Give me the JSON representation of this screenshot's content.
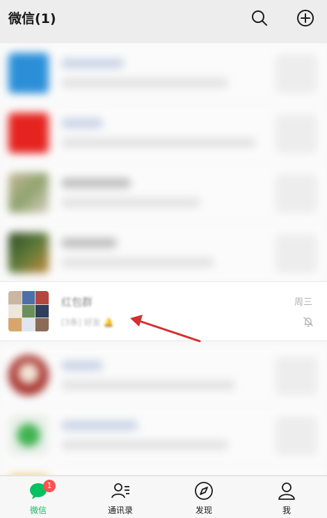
{
  "header": {
    "title": "微信(1)"
  },
  "chat": {
    "name": "红包群",
    "preview": "[3条] 好友 🔔",
    "time": "周三"
  },
  "tabs": [
    {
      "label": "微信",
      "badge": "1"
    },
    {
      "label": "通讯录"
    },
    {
      "label": "发现"
    },
    {
      "label": "我"
    }
  ],
  "colors": {
    "accent": "#07c160",
    "badge": "#fa5151",
    "arrow": "#d32f2f"
  }
}
